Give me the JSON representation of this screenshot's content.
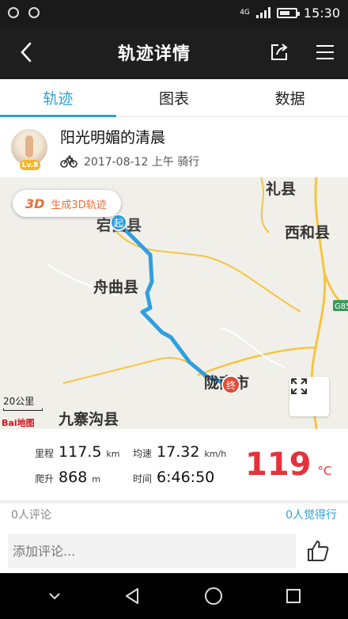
{
  "status_bar": {
    "network": "4G",
    "time": "15:30"
  },
  "header": {
    "title": "轨迹详情"
  },
  "tabs": [
    {
      "label": "轨迹",
      "active": true
    },
    {
      "label": "图表",
      "active": false
    },
    {
      "label": "数据",
      "active": false
    }
  ],
  "user": {
    "name": "阳光明媚的清晨",
    "level": "Lv.8",
    "date": "2017-08-12 上午 骑行"
  },
  "map": {
    "button_3d_badge": "3D",
    "button_3d_label": "生成3D轨迹",
    "labels": {
      "li": "礼县",
      "xihe": "西和县",
      "zhouqu": "舟曲县",
      "longnan": "陇南市",
      "jiuzhaigou": "九寨沟县",
      "start_town": "宕昌县"
    },
    "highway": "G85",
    "start_marker": "起",
    "end_marker": "终",
    "scale": "20公里",
    "logo": "Bai地图"
  },
  "stats": {
    "distance": {
      "label": "里程",
      "value": "117.5",
      "unit": "km"
    },
    "speed": {
      "label": "均速",
      "value": "17.32",
      "unit": "km/h"
    },
    "climb": {
      "label": "爬升",
      "value": "868",
      "unit": "m"
    },
    "duration": {
      "label": "时间",
      "value": "6:46:50"
    },
    "temperature": {
      "value": "119",
      "unit": "°C"
    }
  },
  "social": {
    "comments": "0人评论",
    "likes": "0人觉得行"
  },
  "comment_input": {
    "placeholder": "添加评论..."
  },
  "colors": {
    "accent": "#2aa2d6",
    "route": "#2f9fe0",
    "temp": "#e5323a",
    "road": "#f5c542"
  }
}
